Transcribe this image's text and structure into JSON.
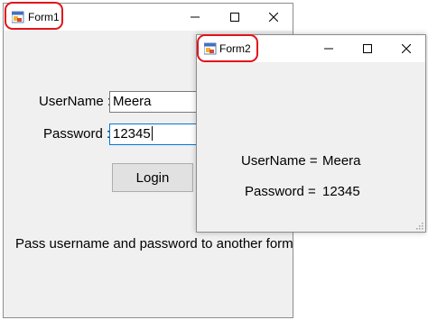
{
  "form1": {
    "title": "Form1",
    "username_label": "UserName :",
    "username_value": "Meera",
    "password_label": "Password :",
    "password_value": "12345",
    "login_button": "Login",
    "message": "Pass username and password to another form"
  },
  "form2": {
    "title": "Form2",
    "username_label": "UserName =",
    "username_value": "Meera",
    "password_label": "Password =",
    "password_value": "12345"
  },
  "colors": {
    "annotation": "#e0141b",
    "window_bg": "#f0f0f0",
    "focus_border": "#0078d7"
  },
  "icons": {
    "window_icon": "winforms-app-icon",
    "minimize": "minimize-icon",
    "maximize": "maximize-icon",
    "close": "close-icon"
  }
}
